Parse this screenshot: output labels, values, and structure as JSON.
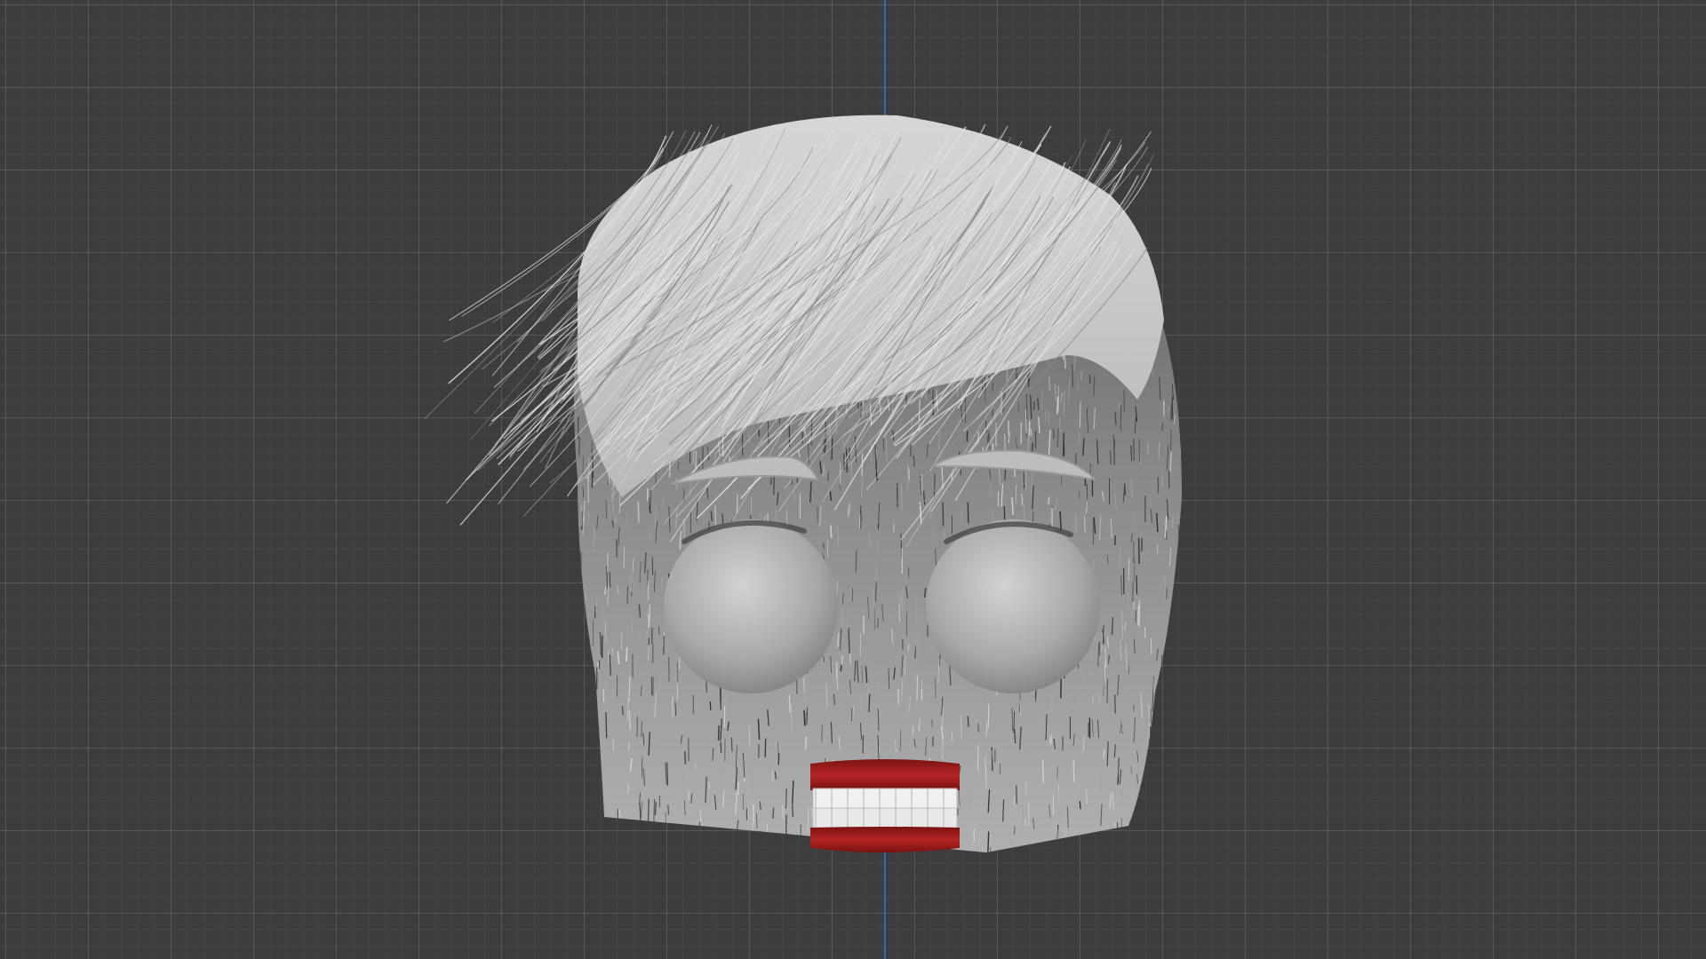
{
  "viewport": {
    "background_color": "#3d3d3d",
    "grid_color": "#4a4a4a",
    "axis_color": "#2f6fb5"
  },
  "model": {
    "hair_color": "#c8c8c8",
    "hair_shadow_color": "#6a6a6a",
    "eye_color": "#b5b5b5",
    "gum_color": "#9e1c1c",
    "teeth_color": "#f0f0f0"
  }
}
